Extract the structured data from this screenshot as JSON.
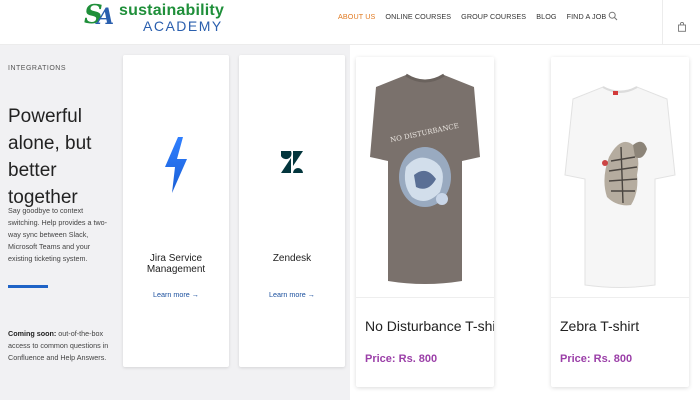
{
  "header": {
    "logo": {
      "mark_s": "S",
      "mark_a": "A",
      "line1": "sustainability",
      "line2": "ACADEMY"
    },
    "nav": [
      {
        "label": "ABOUT US",
        "active": true
      },
      {
        "label": "ONLINE COURSES",
        "active": false
      },
      {
        "label": "GROUP COURSES",
        "active": false
      },
      {
        "label": "BLOG",
        "active": false
      },
      {
        "label": "FIND A JOB",
        "active": false
      }
    ],
    "search_icon": "search-icon",
    "cart_icon": "shopping-bag-icon"
  },
  "teaser": {
    "eyebrow": "INTEGRATIONS",
    "headline": "Powerful alone, but better together",
    "body": "Say goodbye to context switching. Help provides a two-way sync between Slack, Microsoft Teams and your existing ticketing system.",
    "coming_bold": "Coming soon:",
    "coming_rest": " out-of-the-box access to common questions in Confluence and Help Answers.",
    "accent_color": "#1f63c6",
    "apps": [
      {
        "name": "Jira Service Management",
        "link": "Learn more →",
        "icon": "jira-lightning-icon",
        "color": "#2684ff"
      },
      {
        "name": "Zendesk",
        "link": "Learn more →",
        "icon": "zendesk-z-icon",
        "color": "#03363d"
      }
    ]
  },
  "products": [
    {
      "name": "No Disturbance T-shirt",
      "price": "Price: Rs. 800",
      "print_text": "NO DISTURBANCE",
      "shirt_color": "#7a716c"
    },
    {
      "name": "Zebra T-shirt",
      "price": "Price: Rs. 800",
      "shirt_color": "#f6f6f6"
    }
  ],
  "colors": {
    "nav_active": "#e07a22",
    "price": "#9b3fa8",
    "logo_green": "#1f8f3a",
    "logo_blue": "#2a5fae"
  }
}
